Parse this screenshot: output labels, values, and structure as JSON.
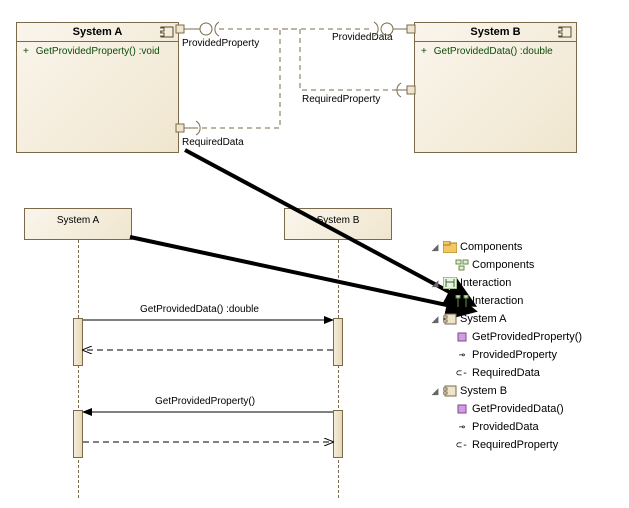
{
  "componentDiagram": {
    "systemA": {
      "name": "System A",
      "operation": "GetProvidedProperty() :void",
      "ports": {
        "providedProperty": "ProvidedProperty",
        "requiredData": "RequiredData"
      }
    },
    "systemB": {
      "name": "System B",
      "operation": "GetProvidedData() :double",
      "ports": {
        "providedData": "ProvidedData",
        "requiredProperty": "RequiredProperty"
      }
    }
  },
  "sequenceDiagram": {
    "lifelineA": "System A",
    "lifelineB": "System B",
    "msg1": "GetProvidedData() :double",
    "msg2": "GetProvidedProperty()"
  },
  "tree": {
    "componentsFolder": "Components",
    "componentsDiagram": "Components",
    "interactionFolder": "Interaction",
    "interactionDiagram": "Interaction",
    "systemA": "System A",
    "systemA_op": "GetProvidedProperty()",
    "systemA_provided": "ProvidedProperty",
    "systemA_required": "RequiredData",
    "systemB": "System B",
    "systemB_op": "GetProvidedData()",
    "systemB_provided": "ProvidedData",
    "systemB_required": "RequiredProperty"
  }
}
